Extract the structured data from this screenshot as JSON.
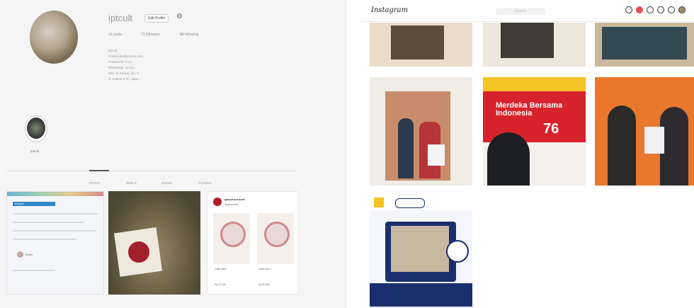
{
  "left": {
    "profile": {
      "username": "iptcult",
      "edit_label": "Edit Profile",
      "stats": [
        "13 posts",
        "71 followers",
        "88 following"
      ],
      "bio_lines": [
        "Iptcult",
        "Portal iptcultsource.com",
        "Postal info: 9 (1) ...",
        "WhatsApp: 18 (2) ...",
        "Info: Jl. Kenari, No. 2 ...",
        "Jl. Institut 8 (F) Jalan ..."
      ],
      "highlight_label": "Iptcult"
    },
    "tabs": [
      "POSTS",
      "REELS",
      "SAVED",
      "TAGGED"
    ],
    "post_card": {
      "account": "iptcult.account",
      "subtitle": "Sponsored",
      "item_left": "Sale item",
      "item_right": "Sale item",
      "price_left": "Rp 5.000",
      "price_right": "Rp 5.000"
    },
    "screenshot_panel": {
      "header": "Shopee",
      "label": "Seller"
    }
  },
  "right": {
    "logo": "Instagram",
    "search_placeholder": "Search",
    "nav_icons": [
      "home-icon",
      "messenger-icon",
      "new-post-icon",
      "explore-icon",
      "heart-icon",
      "avatar-icon"
    ],
    "grid": {
      "post5_title": "Merdeka Bersama Indonesia",
      "post5_number": "76"
    }
  }
}
